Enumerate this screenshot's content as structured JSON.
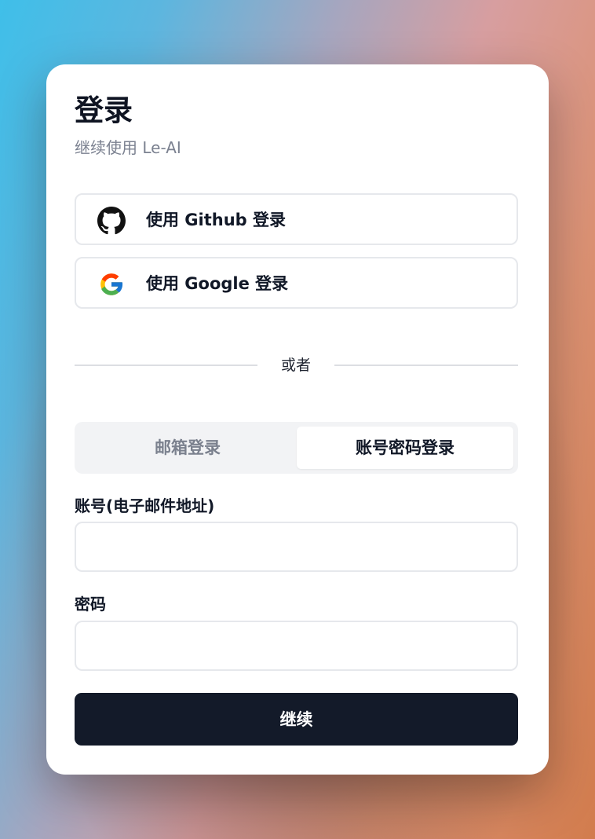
{
  "header": {
    "title": "登录",
    "subtitle": "继续使用 Le-AI"
  },
  "oauth": {
    "github": {
      "label": "使用 Github 登录",
      "icon": "github-icon"
    },
    "google": {
      "label": "使用 Google 登录",
      "icon": "google-icon"
    }
  },
  "divider": {
    "text": "或者"
  },
  "tabs": {
    "items": [
      {
        "label": "邮箱登录",
        "active": false
      },
      {
        "label": "账号密码登录",
        "active": true
      }
    ]
  },
  "form": {
    "account": {
      "label": "账号(电子邮件地址)",
      "value": "",
      "placeholder": ""
    },
    "password": {
      "label": "密码",
      "value": "",
      "placeholder": ""
    },
    "submit_label": "继续"
  },
  "colors": {
    "primary_button": "#131a29",
    "text_primary": "#111827",
    "text_muted": "#7b8190",
    "border": "#e6e8ec",
    "tab_bg": "#f2f3f5"
  }
}
